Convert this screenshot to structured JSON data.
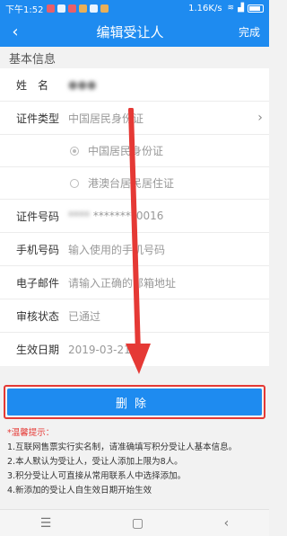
{
  "status_bar": {
    "time": "下午1:52",
    "network_speed": "1.16K/s",
    "signal": "all"
  },
  "nav": {
    "back_icon": "chevron-left-icon",
    "title": "编辑受让人",
    "done_label": "完成"
  },
  "section": {
    "title": "基本信息"
  },
  "form": {
    "name_label": "姓名",
    "name_value": "●●●",
    "id_type_label": "证件类型",
    "id_type_value": "中国居民身份证",
    "id_type_options": [
      "中国居民身份证",
      "港澳台居民居住证"
    ],
    "id_number_label": "证件号码",
    "id_number_value": "****",
    "id_number_masked": "********0016",
    "phone_label": "手机号码",
    "phone_placeholder": "输入使用的手机号码",
    "email_label": "电子邮件",
    "email_placeholder": "请输入正确的邮箱地址",
    "review_label": "审核状态",
    "review_value": "已通过",
    "effective_label": "生效日期",
    "effective_value": "2019-03-21"
  },
  "delete_button": {
    "label": "删除"
  },
  "tips": {
    "title": "*温馨提示：",
    "lines": [
      "1.互联网售票实行实名制，请准确填写积分受让人基本信息。",
      "2.本人默认为受让人，受让人添加上限为8人。",
      "3.积分受让人可直接从常用联系人中选择添加。",
      "4.新添加的受让人自生效日期开始生效"
    ]
  },
  "system_nav": {
    "menu_icon": "menu-icon",
    "home_icon": "home-square-icon",
    "back_icon": "back-chevron-icon"
  },
  "colors": {
    "accent": "#1e8bf0",
    "highlight": "#e53935"
  }
}
